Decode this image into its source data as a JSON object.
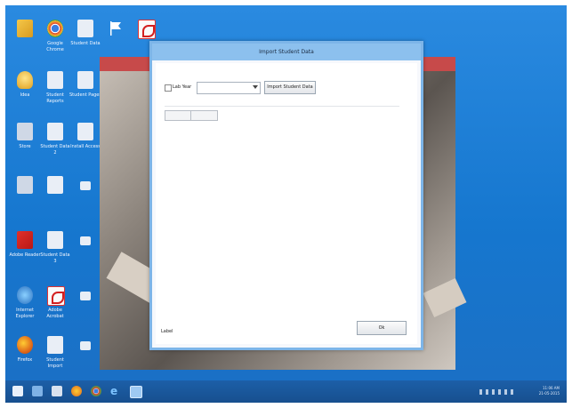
{
  "desktop": {
    "icons": [
      {
        "name": "folder",
        "label": ""
      },
      {
        "name": "chrome",
        "label": "Google Chrome"
      },
      {
        "name": "document",
        "label": "Student Data"
      },
      {
        "name": "flag",
        "label": ""
      },
      {
        "name": "pdf",
        "label": ""
      },
      {
        "name": "bulb",
        "label": "Idea"
      },
      {
        "name": "document",
        "label": "Student Reports"
      },
      {
        "name": "document",
        "label": "Student Pages"
      },
      {
        "name": "store",
        "label": "Store"
      },
      {
        "name": "document",
        "label": "Student Data 2"
      },
      {
        "name": "document",
        "label": "Install Access"
      },
      {
        "name": "store",
        "label": ""
      },
      {
        "name": "document",
        "label": ""
      },
      {
        "name": "small",
        "label": ""
      },
      {
        "name": "pdf",
        "label": "Adobe Reader"
      },
      {
        "name": "document",
        "label": "Student Data 3"
      },
      {
        "name": "small",
        "label": ""
      },
      {
        "name": "globe",
        "label": "Internet Explorer"
      },
      {
        "name": "pdf",
        "label": "Adobe Acrobat"
      },
      {
        "name": "small",
        "label": ""
      },
      {
        "name": "firefox",
        "label": "Firefox"
      },
      {
        "name": "document",
        "label": "Student Import"
      },
      {
        "name": "small",
        "label": ""
      }
    ]
  },
  "dialog": {
    "title": "Import Student Data",
    "checkbox_label": "Lab Year",
    "select_value": "",
    "import_button": "Import Student Data",
    "status_text": "Label",
    "ok_button": "Ok"
  },
  "taskbar": {
    "time": "11:06 AM",
    "date": "21-05-2015"
  }
}
